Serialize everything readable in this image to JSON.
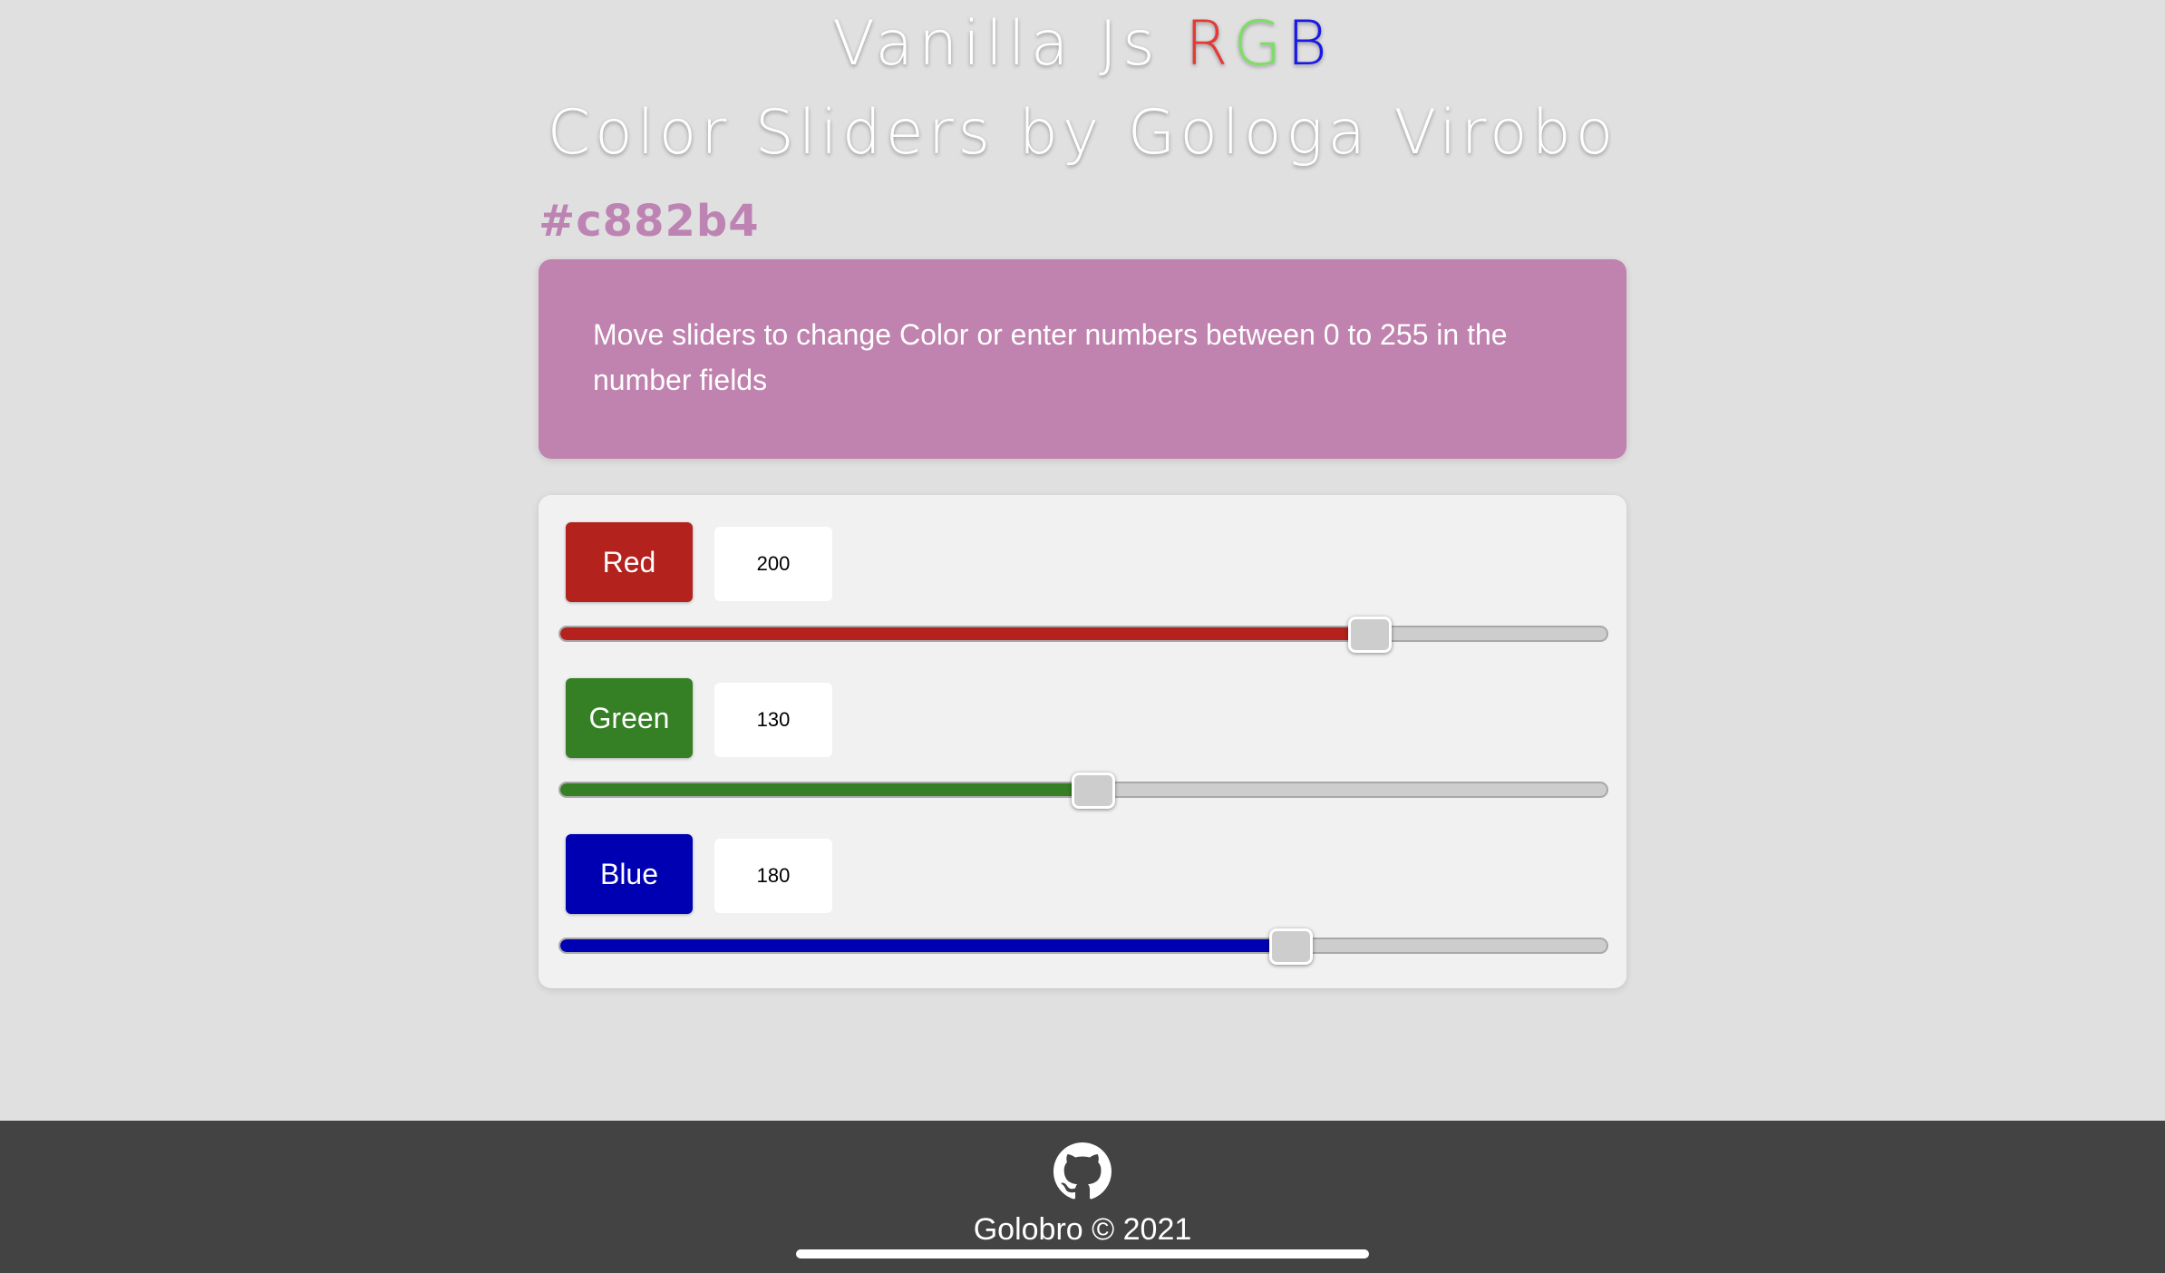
{
  "header": {
    "title_prefix": "Vanilla Js ",
    "title_r": "R",
    "title_g": "G",
    "title_b": "B",
    "subtitle": "Color Sliders by Gologa Virobo"
  },
  "hex_code": "#c882b4",
  "preview": {
    "color": "#c082ae",
    "message": "Move sliders to change Color or enter numbers between 0 to 255 in the number fields"
  },
  "sliders": [
    {
      "label": "Red",
      "value": "200",
      "max": 255,
      "color": "#b3221d"
    },
    {
      "label": "Green",
      "value": "130",
      "max": 255,
      "color": "#357f25"
    },
    {
      "label": "Blue",
      "value": "180",
      "max": 255,
      "color": "#0000b3"
    }
  ],
  "footer": {
    "icon": "github-icon",
    "text": "Golobro © 2021"
  }
}
